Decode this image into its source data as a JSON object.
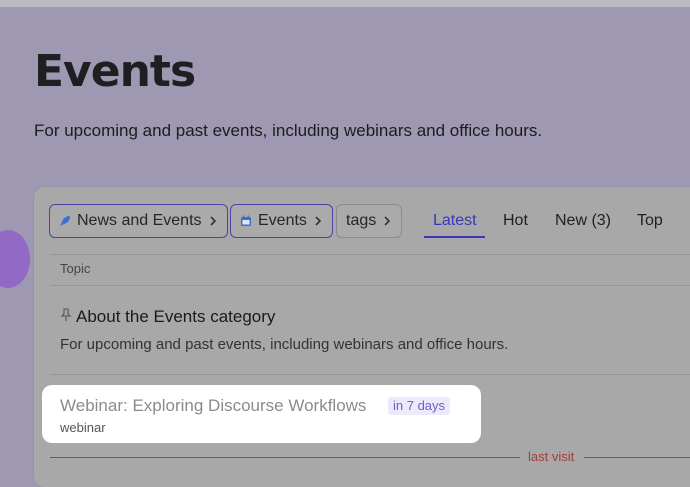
{
  "hero": {
    "title": "Events",
    "description": "For upcoming and past events, including webinars and office hours."
  },
  "breadcrumbs": [
    {
      "label": "News and Events",
      "icon": "rocket-icon"
    },
    {
      "label": "Events",
      "icon": "calendar-icon"
    },
    {
      "label": "tags"
    }
  ],
  "nav": {
    "latest": "Latest",
    "hot": "Hot",
    "new": "New (3)",
    "top": "Top"
  },
  "list": {
    "column_header": "Topic",
    "pinned_topic": {
      "title": "About the Events category",
      "excerpt": "For upcoming and past events, including webinars and office hours.",
      "icon": "pin-icon"
    },
    "highlighted_topic": {
      "title": "Webinar: Exploring Discourse Workflows",
      "badge": "in 7 days",
      "tag": "webinar"
    },
    "last_visit": "last visit"
  },
  "colors": {
    "accent": "#3a37b8",
    "background": "#9f98b3",
    "last_visit": "#a94342"
  }
}
